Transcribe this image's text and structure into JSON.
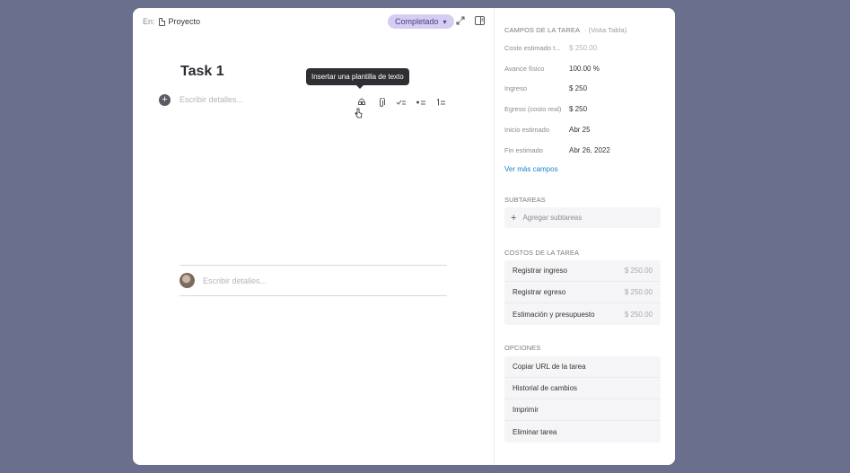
{
  "breadcrumb": {
    "prefix": "En:",
    "location": "Proyecto"
  },
  "status": {
    "label": "Completado",
    "color": "#d6cdf2"
  },
  "header_icons": [
    "expand-icon",
    "sidebar-layout-icon"
  ],
  "task": {
    "title": "Task 1",
    "details_placeholder": "Escribir detalles...",
    "tooltip": "Insertar una plantilla de texto"
  },
  "toolbar_icons": [
    "template-icon",
    "attachment-icon",
    "checklist-icon",
    "bullet-list-icon",
    "numbered-list-icon"
  ],
  "comment": {
    "placeholder": "Escribir detalles..."
  },
  "fields_section": {
    "title": "CAMPOS DE LA TAREA",
    "subtitle": "· (Vista Tabla)",
    "fields": [
      {
        "label": "Costo estimado t...",
        "value": "$ 250.00",
        "placeholder": true
      },
      {
        "label": "Avance físico",
        "value": "100.00 %",
        "placeholder": false
      },
      {
        "label": "Ingreso",
        "value": "$ 250",
        "placeholder": false
      },
      {
        "label": "Egreso (costo real)",
        "value": "$ 250",
        "placeholder": false
      },
      {
        "label": "Inicio estimado",
        "value": "Abr 25",
        "placeholder": false
      },
      {
        "label": "Fin estimado",
        "value": "Abr 26, 2022",
        "placeholder": false
      }
    ],
    "more_link": "Ver más campos"
  },
  "subtasks": {
    "title": "SUBTAREAS",
    "add_label": "Agregar subtareas"
  },
  "costs": {
    "title": "COSTOS DE LA TAREA",
    "items": [
      {
        "label": "Registrar ingreso",
        "amount": "$ 250.00"
      },
      {
        "label": "Registrar egreso",
        "amount": "$ 250.00"
      },
      {
        "label": "Estimación y presupuesto",
        "amount": "$ 250.00"
      }
    ]
  },
  "options": {
    "title": "OPCIONES",
    "items": [
      "Copiar URL de la tarea",
      "Historial de cambios",
      "Imprimir",
      "Eliminar tarea"
    ]
  }
}
